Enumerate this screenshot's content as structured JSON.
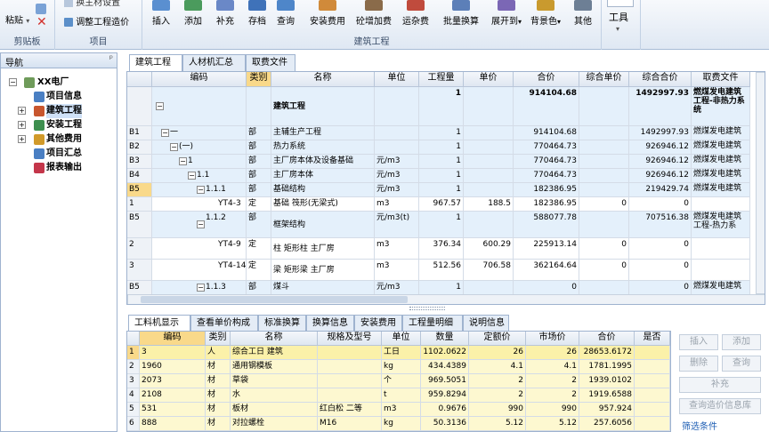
{
  "ribbon": {
    "clipboard": {
      "paste": "粘贴",
      "label": "剪贴板"
    },
    "project": {
      "item1": "换主材设置",
      "item2": "调整工程造价",
      "label": "项目"
    },
    "building": {
      "label": "建筑工程",
      "buttons": [
        "插入",
        "添加",
        "补充",
        "存档",
        "查询",
        "安装费用",
        "砼增加费",
        "运杂费",
        "批量换算",
        "展开到",
        "背景色",
        "其他"
      ]
    },
    "tools": {
      "label": "工具"
    }
  },
  "nav": {
    "title": "导航",
    "pin": "ᵖ",
    "root": "XX电厂",
    "items": [
      "项目信息",
      "建筑工程",
      "安装工程",
      "其他费用",
      "项目汇总",
      "报表输出"
    ]
  },
  "main_tabs": [
    "建筑工程",
    "人材机汇总",
    "取费文件"
  ],
  "main_grid": {
    "headers": [
      "编码",
      "类别",
      "名称",
      "单位",
      "工程量",
      "单价",
      "合价",
      "综合单价",
      "综合合价",
      "取费文件"
    ],
    "rows": [
      {
        "idx": "",
        "code": "",
        "type": "",
        "name": "建筑工程",
        "unit": "",
        "qty": "1",
        "price": "",
        "total": "914104.68",
        "comp_price": "",
        "comp_total": "1492997.93",
        "fee": "燃煤发电建筑工程-非热力系统"
      },
      {
        "idx": "B1",
        "code": "一",
        "type": "部",
        "name": "主辅生产工程",
        "unit": "",
        "qty": "1",
        "price": "",
        "total": "914104.68",
        "comp_price": "",
        "comp_total": "1492997.93",
        "fee": "燃煤发电建筑"
      },
      {
        "idx": "B2",
        "code": "(一)",
        "type": "部",
        "name": "热力系统",
        "unit": "",
        "qty": "1",
        "price": "",
        "total": "770464.73",
        "comp_price": "",
        "comp_total": "926946.12",
        "fee": "燃煤发电建筑"
      },
      {
        "idx": "B3",
        "code": "1",
        "type": "部",
        "name": "主厂房本体及设备基础",
        "unit": "元/m3",
        "qty": "1",
        "price": "",
        "total": "770464.73",
        "comp_price": "",
        "comp_total": "926946.12",
        "fee": "燃煤发电建筑"
      },
      {
        "idx": "B4",
        "code": "1.1",
        "type": "部",
        "name": "主厂房本体",
        "unit": "元/m3",
        "qty": "1",
        "price": "",
        "total": "770464.73",
        "comp_price": "",
        "comp_total": "926946.12",
        "fee": "燃煤发电建筑"
      },
      {
        "idx": "B5",
        "code": "1.1.1",
        "type": "部",
        "name": "基础结构",
        "unit": "元/m3",
        "qty": "1",
        "price": "",
        "total": "182386.95",
        "comp_price": "",
        "comp_total": "219429.74",
        "fee": "燃煤发电建筑"
      },
      {
        "idx": "1",
        "code": "YT4-3",
        "type": "定",
        "name": "基础 筏形(无梁式)",
        "unit": "m3",
        "qty": "967.57",
        "price": "188.5",
        "total": "182386.95",
        "comp_price": "0",
        "comp_total": "0",
        "fee": ""
      },
      {
        "idx": "B5",
        "code": "1.1.2",
        "type": "部",
        "name": "框架结构",
        "unit": "元/m3(t)",
        "qty": "1",
        "price": "",
        "total": "588077.78",
        "comp_price": "",
        "comp_total": "707516.38",
        "fee": "燃煤发电建筑工程-热力系"
      },
      {
        "idx": "2",
        "code": "YT4-9",
        "type": "定",
        "name": "柱 矩形柱 主厂房",
        "unit": "m3",
        "qty": "376.34",
        "price": "600.29",
        "total": "225913.14",
        "comp_price": "0",
        "comp_total": "0",
        "fee": ""
      },
      {
        "idx": "3",
        "code": "YT4-14",
        "type": "定",
        "name": "梁 矩形梁 主厂房",
        "unit": "m3",
        "qty": "512.56",
        "price": "706.58",
        "total": "362164.64",
        "comp_price": "0",
        "comp_total": "0",
        "fee": ""
      },
      {
        "idx": "B5",
        "code": "1.1.3",
        "type": "部",
        "name": "煤斗",
        "unit": "元/m3",
        "qty": "1",
        "price": "",
        "total": "0",
        "comp_price": "",
        "comp_total": "0",
        "fee": "燃煤发电建筑"
      }
    ]
  },
  "bottom_tabs": [
    "工料机显示",
    "查看单价构成",
    "标准换算",
    "换算信息",
    "安装费用",
    "工程量明细",
    "说明信息"
  ],
  "bottom_grid": {
    "headers": [
      "编码",
      "类别",
      "名称",
      "规格及型号",
      "单位",
      "数量",
      "定额价",
      "市场价",
      "合价",
      "是否"
    ],
    "rows": [
      {
        "idx": "1",
        "code": "3",
        "type": "人",
        "name": "综合工日 建筑",
        "spec": "",
        "unit": "工日",
        "qty": "1102.0622",
        "base": "26",
        "market": "26",
        "total": "28653.6172"
      },
      {
        "idx": "2",
        "code": "1960",
        "type": "材",
        "name": "通用钢模板",
        "spec": "",
        "unit": "kg",
        "qty": "434.4389",
        "base": "4.1",
        "market": "4.1",
        "total": "1781.1995"
      },
      {
        "idx": "3",
        "code": "2073",
        "type": "材",
        "name": "草袋",
        "spec": "",
        "unit": "个",
        "qty": "969.5051",
        "base": "2",
        "market": "2",
        "total": "1939.0102"
      },
      {
        "idx": "4",
        "code": "2108",
        "type": "材",
        "name": "水",
        "spec": "",
        "unit": "t",
        "qty": "959.8294",
        "base": "2",
        "market": "2",
        "total": "1919.6588"
      },
      {
        "idx": "5",
        "code": "531",
        "type": "材",
        "name": "板材",
        "spec": "红白松 二等",
        "unit": "m3",
        "qty": "0.9676",
        "base": "990",
        "market": "990",
        "total": "957.924"
      },
      {
        "idx": "6",
        "code": "888",
        "type": "材",
        "name": "对拉螺栓",
        "spec": "M16",
        "unit": "kg",
        "qty": "50.3136",
        "base": "5.12",
        "market": "5.12",
        "total": "257.6056"
      }
    ]
  },
  "side_buttons": {
    "insert": "插入",
    "add": "添加",
    "delete": "删除",
    "query": "查询",
    "supplement": "补充",
    "price_lib": "查询造价信息库",
    "filter": "筛选条件"
  }
}
